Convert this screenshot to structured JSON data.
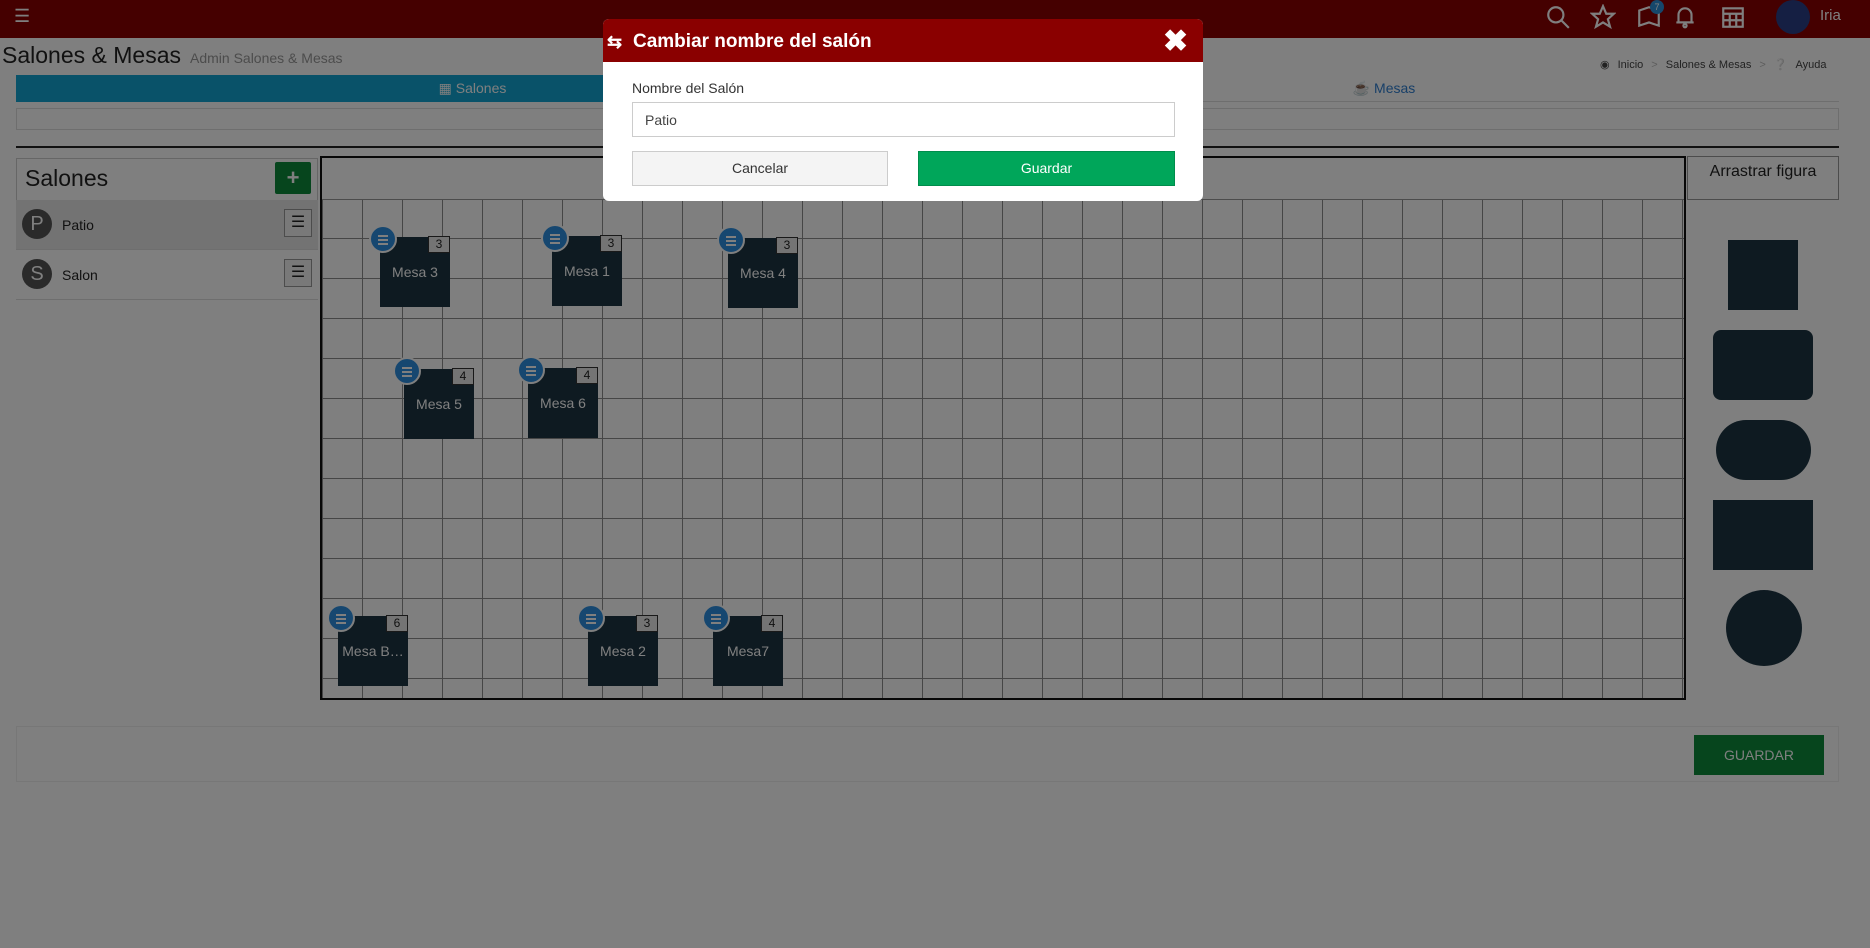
{
  "topbar": {
    "menu_icon": "hamburger-icon",
    "icons": [
      "search-icon",
      "star-icon",
      "book-icon",
      "bell-icon",
      "calendar-icon"
    ],
    "notifications_badge": "7",
    "username": "Iria"
  },
  "header": {
    "title": "Salones & Mesas",
    "subtitle": "Admin Salones & Mesas",
    "breadcrumb": [
      "Inicio",
      "Salones & Mesas"
    ],
    "help": "Ayuda"
  },
  "tabs": {
    "salones": "Salones",
    "mesas": "Mesas"
  },
  "salones": {
    "title": "Salones",
    "add_label": "+",
    "items": [
      {
        "letter": "P",
        "name": "Patio"
      },
      {
        "letter": "S",
        "name": "Salon"
      }
    ]
  },
  "mesas": [
    {
      "name": "Mesa 3",
      "capacity": "3"
    },
    {
      "name": "Mesa 1",
      "capacity": "3"
    },
    {
      "name": "Mesa 4",
      "capacity": "3"
    },
    {
      "name": "Mesa 5",
      "capacity": "4"
    },
    {
      "name": "Mesa 6",
      "capacity": "4"
    },
    {
      "name": "Mesa B…",
      "capacity": "6"
    },
    {
      "name": "Mesa 2",
      "capacity": "3"
    },
    {
      "name": "Mesa7",
      "capacity": "4"
    }
  ],
  "figures": {
    "title": "Arrastrar figura"
  },
  "footer": {
    "save_label": "GUARDAR"
  },
  "modal": {
    "title": "Cambiar nombre del salón",
    "field_label": "Nombre del Salón",
    "field_value": "Patio",
    "cancel_label": "Cancelar",
    "save_label": "Guardar"
  },
  "colors": {
    "brand": "#8a0000",
    "tab_active": "#13a5d2",
    "save_green": "#00a65a",
    "table_fill": "#1d3542"
  }
}
